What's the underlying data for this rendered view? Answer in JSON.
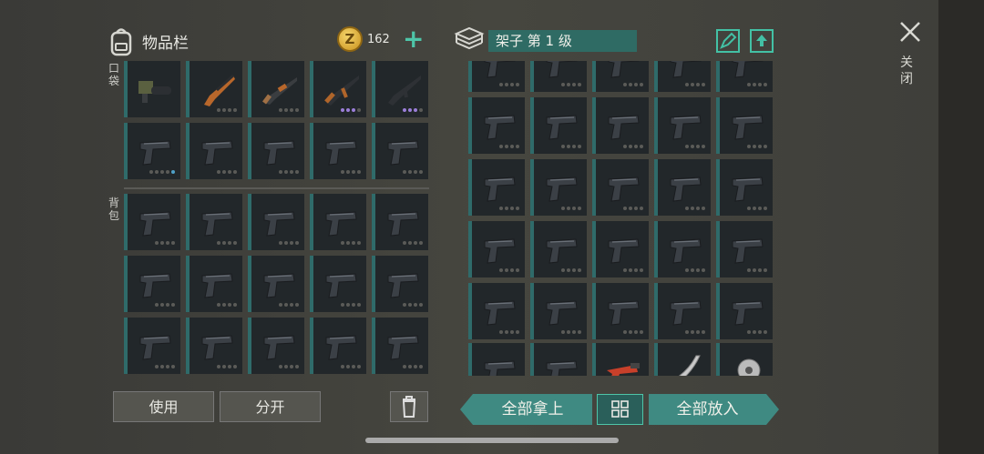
{
  "inventory": {
    "title": "物品栏",
    "coins": "162",
    "coin_symbol": "Z"
  },
  "sections": {
    "pockets": "口袋",
    "backpack": "背包"
  },
  "shelf": {
    "name": "架子 第 1 级"
  },
  "close_label": "关闭",
  "buttons": {
    "use": "使用",
    "split": "分开",
    "take_all": "全部拿上",
    "put_all": "全部放入"
  },
  "left_items": [
    {
      "row": 0,
      "col": 0,
      "type": "grenade-launcher",
      "dots": []
    },
    {
      "row": 0,
      "col": 1,
      "type": "hunting-rifle",
      "dots": [
        "g",
        "g",
        "g",
        "g"
      ]
    },
    {
      "row": 0,
      "col": 2,
      "type": "shotgun",
      "dots": [
        "g",
        "g",
        "g",
        "g"
      ]
    },
    {
      "row": 0,
      "col": 3,
      "type": "ak-rifle",
      "dots": [
        "p",
        "p",
        "p",
        "g"
      ]
    },
    {
      "row": 0,
      "col": 4,
      "type": "assault-rifle",
      "dots": [
        "p",
        "p",
        "p",
        "g"
      ]
    },
    {
      "row": 1,
      "col": 0,
      "type": "pistol",
      "dots": [
        "g",
        "g",
        "g",
        "g",
        "b"
      ]
    }
  ],
  "right_bottom_items": [
    "pistol",
    "pistol",
    "flare-gun",
    "machete",
    "sawblade-item"
  ]
}
